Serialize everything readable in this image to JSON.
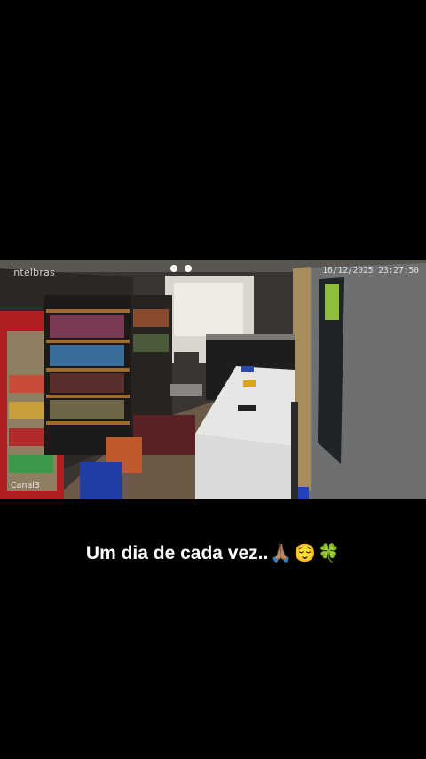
{
  "video": {
    "brand": "intelbras",
    "timestamp": "16/12/2025 23:27:50",
    "channel": "Canal3"
  },
  "caption": {
    "text": "Um dia de cada vez..",
    "emojis": [
      "🙏🏽",
      "😌",
      "🍀"
    ]
  }
}
